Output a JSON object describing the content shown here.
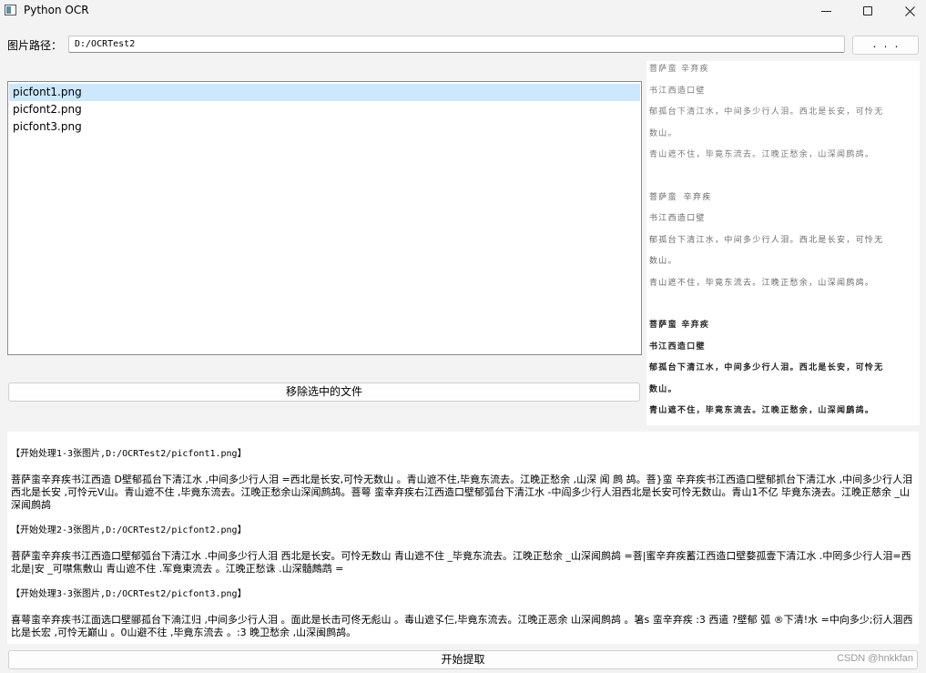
{
  "window": {
    "title": "Python OCR"
  },
  "path": {
    "label": "图片路径：",
    "value": "D:/OCRTest2",
    "browse_label": ". . ."
  },
  "file_list": {
    "items": [
      "picfont1.png",
      "picfont2.png",
      "picfont3.png"
    ],
    "selected_index": 0
  },
  "remove_button": "移除选中的文件",
  "preview": {
    "block1": [
      "菩萨蛮  辛弃疾",
      "书江西造口壁",
      "郁孤台下清江水，中间多少行人泪。西北是长安，可怜无",
      "数山。",
      "青山遮不住，毕竟东流去。江晚正愁余，山深闻鹧鸪。"
    ],
    "block2": [
      "菩萨蛮  辛弃疾",
      "书江西造口壁",
      "郁孤台下清江水，中间多少行人泪。西北是长安，可怜无",
      "数山。",
      "青山遮不住，毕竟东流去。江晚正愁余，山深闻鹧鸪。"
    ],
    "block3": [
      "菩萨蛮  辛弃疾",
      "书江西造口壁",
      "郁孤台下清江水，中间多少行人泪。西北是长安，可怜无",
      "数山。",
      "青山遮不住，毕竟东流去。江晚正愁余，山深闻鹧鸪。"
    ]
  },
  "output": {
    "header1": "【开始处理1-3张图片,D:/OCRTest2/picfont1.png】",
    "text1": "菩萨蛮辛弃疾书江西造 D壁郁孤台下清江水 ,中间多少行人泪 =西北是长安,可怜无数山 。青山遮不住,毕竟东流去。江晚正愁余 ,山深 闻 鹧 鸪。菩}蛮   辛弃疾书江西造口壁郁抓台下清江水 ,中间多少行人泪西北是长安 ,可怜元V山。青山遮不住 ,毕竟东流去。江晚正愁余山深闻鹧鸪。菩萼   蛮幸弃疾右江西造口壁郁弧台下清江水 -中阎多少行人泪西北是长安可怜无数山。青山1不亿 毕竟东浇去。江晚正慈余 _山深闻鹧鸪",
    "header2": "【开始处理2-3张图片,D:/OCRTest2/picfont2.png】",
    "text2": "菩萨蛮辛弃疾书江西造口壁郁弧台下清江水 .中间多少行人泪 西北是长安。可怜无数山 青山遮不住 _毕竟东流去。江晚正愁余 _山深闻鹧鸪 =菩|蜜辛弃疾蓄江西造口壁婺孤壹下清江水 .中罔多少行人泪=西北是|安 _可噤焦敷山 青山遮不住 .军竟東流去 。江晚正愁诛 .山深髓鷓鹉 =",
    "header3": "【开始处理3-3张图片,D:/OCRTest2/picfont3.png】",
    "text3": "喜萼蛮辛弃疾书江面选口壁郦孤台下湳江归 ,中间多少行人泪 。面此是长击可佟无彪山 。毒山遮孓仨,毕竟东流去。江晚正恶余 山深闻鹧鸪 。箸s  蛮辛弃疾 :3 西遣 ?壁郁  弧  ®下清!水 =中向多少;衍人涸西 比是长宏 ,可怜无巅山 。0山避不往 ,毕竟东流去 。:3  晚卫愁余 ,山深闽鹧鸪。"
  },
  "extract_button": "开始提取",
  "watermark": "CSDN @hnkkfan"
}
